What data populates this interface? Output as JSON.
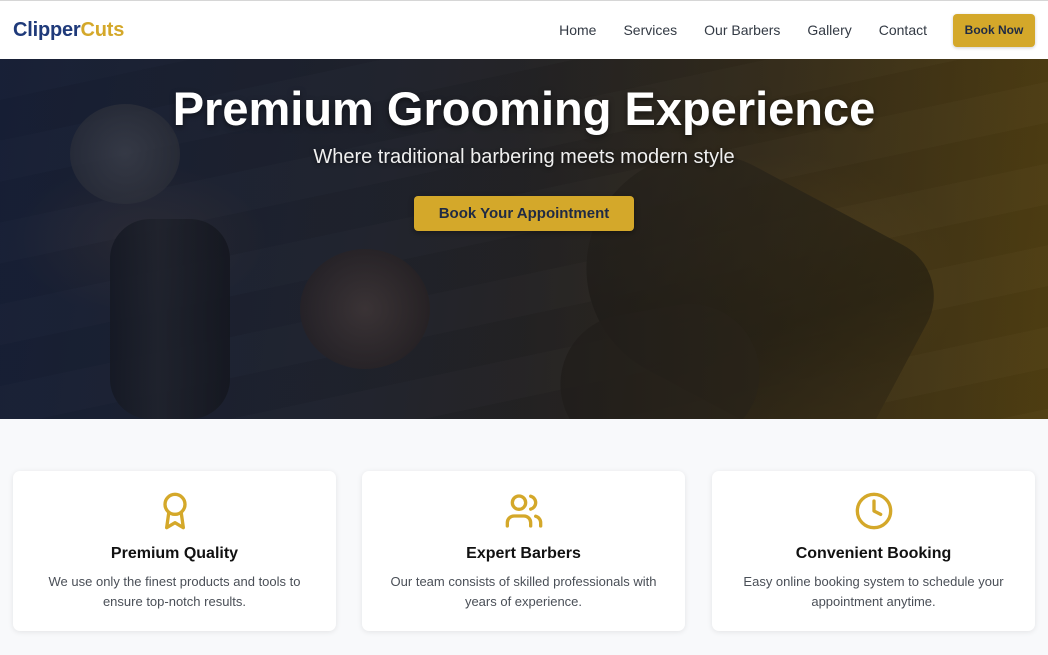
{
  "brand": {
    "name_part1": "Clipper",
    "name_part2": "Cuts"
  },
  "nav": {
    "links": [
      "Home",
      "Services",
      "Our Barbers",
      "Gallery",
      "Contact"
    ],
    "book_label": "Book Now"
  },
  "hero": {
    "title": "Premium Grooming Experience",
    "subtitle": "Where traditional barbering meets modern style",
    "cta_label": "Book Your Appointment"
  },
  "features": [
    {
      "icon": "award-icon",
      "title": "Premium Quality",
      "description": "We use only the finest products and tools to ensure top-notch results."
    },
    {
      "icon": "users-icon",
      "title": "Expert Barbers",
      "description": "Our team consists of skilled professionals with years of experience."
    },
    {
      "icon": "clock-icon",
      "title": "Convenient Booking",
      "description": "Easy online booking system to schedule your appointment anytime."
    }
  ],
  "colors": {
    "accent": "#d4a82a",
    "brand_primary": "#1f3a7a"
  }
}
